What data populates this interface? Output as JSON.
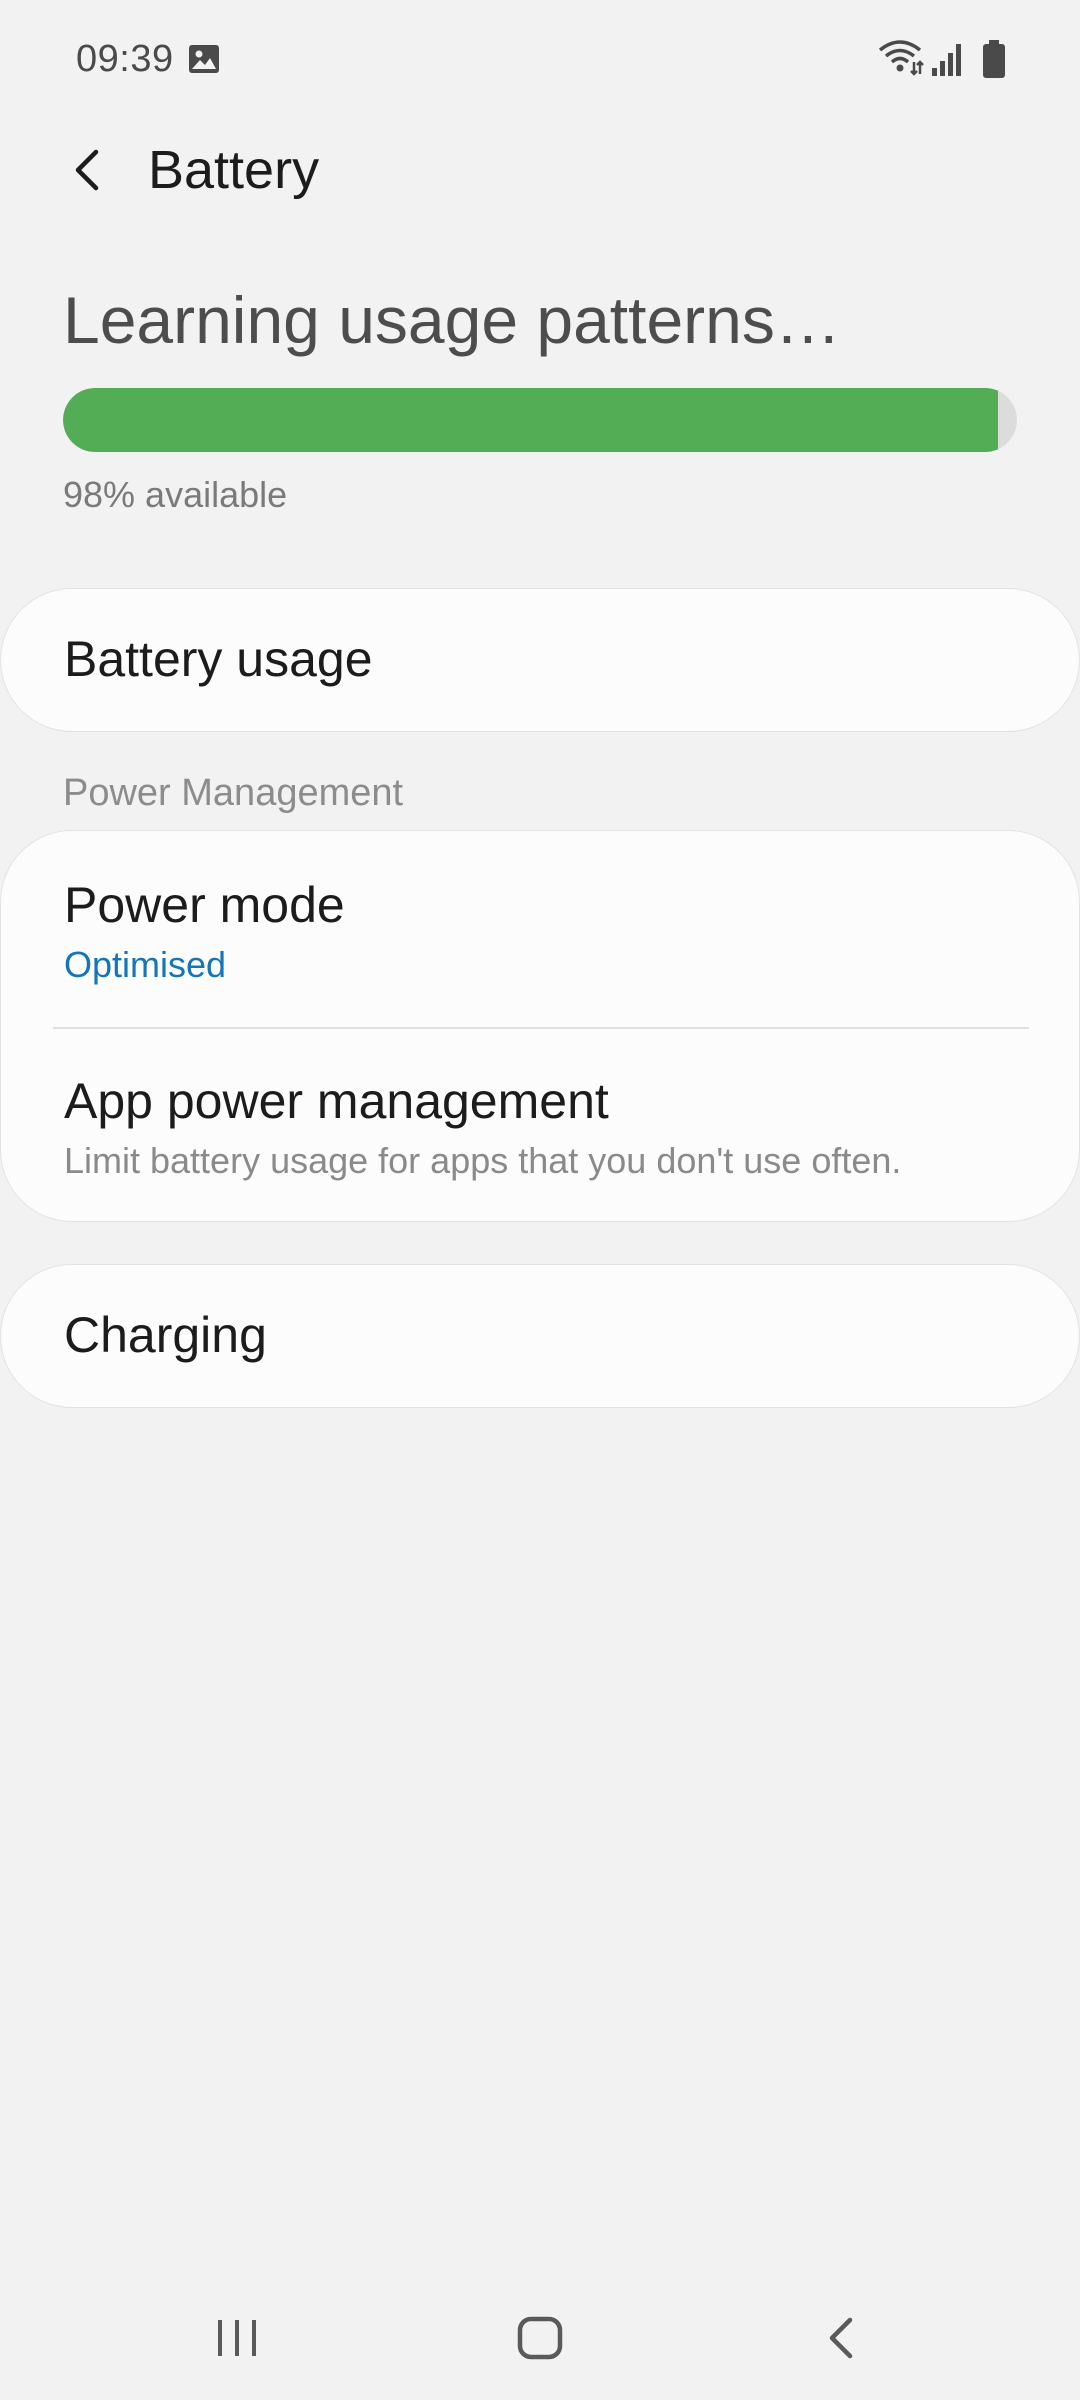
{
  "status_bar": {
    "time": "09:39",
    "icons": [
      "gallery-icon",
      "wifi-icon",
      "signal-icon",
      "battery-icon"
    ]
  },
  "header": {
    "title": "Battery",
    "back_icon": "chevron-left-icon"
  },
  "battery": {
    "status_title": "Learning usage patterns…",
    "available_text": "98% available",
    "level_percent": 98,
    "bar_color": "#52ad55"
  },
  "cards": {
    "battery_usage": {
      "title": "Battery usage"
    },
    "power_management": {
      "section_header": "Power Management",
      "power_mode": {
        "title": "Power mode",
        "value": "Optimised"
      },
      "app_power": {
        "title": "App power management",
        "subtitle": "Limit battery usage for apps that you don't use often."
      }
    },
    "charging": {
      "title": "Charging"
    }
  },
  "colors": {
    "accent": "#1475b8",
    "background": "#f2f2f2",
    "card": "#fcfcfc"
  },
  "nav_bar": {
    "icons": [
      "recents-icon",
      "home-icon",
      "back-icon"
    ]
  }
}
